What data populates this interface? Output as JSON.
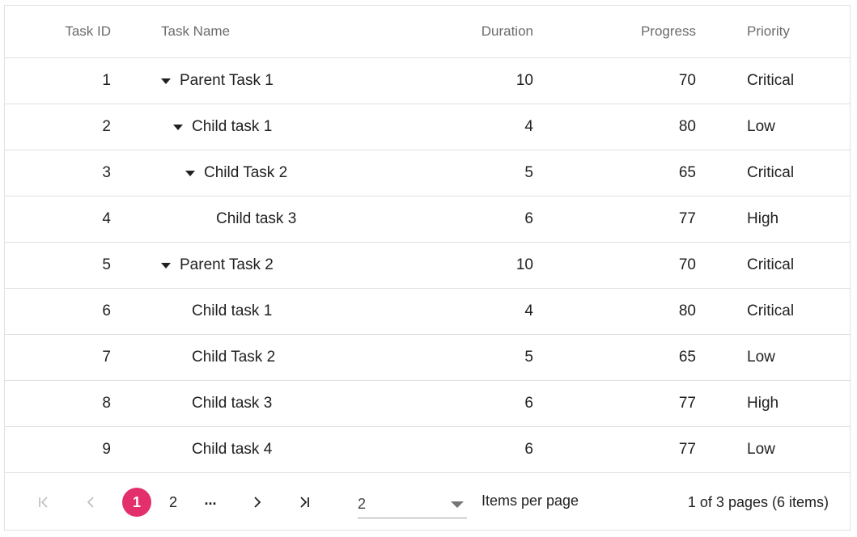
{
  "columns": {
    "task_id": "Task ID",
    "task_name": "Task Name",
    "duration": "Duration",
    "progress": "Progress",
    "priority": "Priority"
  },
  "rows": [
    {
      "id": "1",
      "name": "Parent Task 1",
      "duration": "10",
      "progress": "70",
      "priority": "Critical",
      "level": 0,
      "expanded": true
    },
    {
      "id": "2",
      "name": "Child task 1",
      "duration": "4",
      "progress": "80",
      "priority": "Low",
      "level": 1,
      "expanded": true
    },
    {
      "id": "3",
      "name": "Child Task 2",
      "duration": "5",
      "progress": "65",
      "priority": "Critical",
      "level": 2,
      "expanded": true
    },
    {
      "id": "4",
      "name": "Child task 3",
      "duration": "6",
      "progress": "77",
      "priority": "High",
      "level": 3,
      "expanded": false
    },
    {
      "id": "5",
      "name": "Parent Task 2",
      "duration": "10",
      "progress": "70",
      "priority": "Critical",
      "level": 0,
      "expanded": true
    },
    {
      "id": "6",
      "name": "Child task 1",
      "duration": "4",
      "progress": "80",
      "priority": "Critical",
      "level": 1,
      "expanded": false
    },
    {
      "id": "7",
      "name": "Child Task 2",
      "duration": "5",
      "progress": "65",
      "priority": "Low",
      "level": 1,
      "expanded": false
    },
    {
      "id": "8",
      "name": "Child task 3",
      "duration": "6",
      "progress": "77",
      "priority": "High",
      "level": 1,
      "expanded": false
    },
    {
      "id": "9",
      "name": "Child task 4",
      "duration": "6",
      "progress": "77",
      "priority": "Low",
      "level": 1,
      "expanded": false
    }
  ],
  "pager": {
    "first_icon": "first-page-icon",
    "prev_icon": "previous-page-icon",
    "pages": [
      "1",
      "2"
    ],
    "current_page": "1",
    "more": "...",
    "next_icon": "next-page-icon",
    "last_icon": "last-page-icon",
    "page_size_value": "2",
    "items_per_page_label": "Items per page",
    "info": "1 of 3 pages (6 items)"
  },
  "colors": {
    "accent": "#e3306c",
    "border": "#e0e0e0",
    "header_text": "#6b6b6b"
  }
}
